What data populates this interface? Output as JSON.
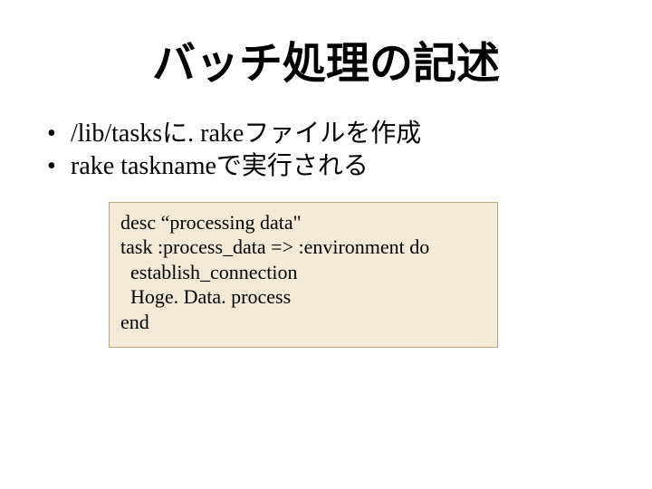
{
  "title": "バッチ処理の記述",
  "bullets": [
    "/lib/tasksに. rakeファイルを作成",
    "rake tasknameで実行される"
  ],
  "code": "desc “processing data\"\ntask :process_data => :environment do\n  establish_connection\n  Hoge. Data. process\nend"
}
